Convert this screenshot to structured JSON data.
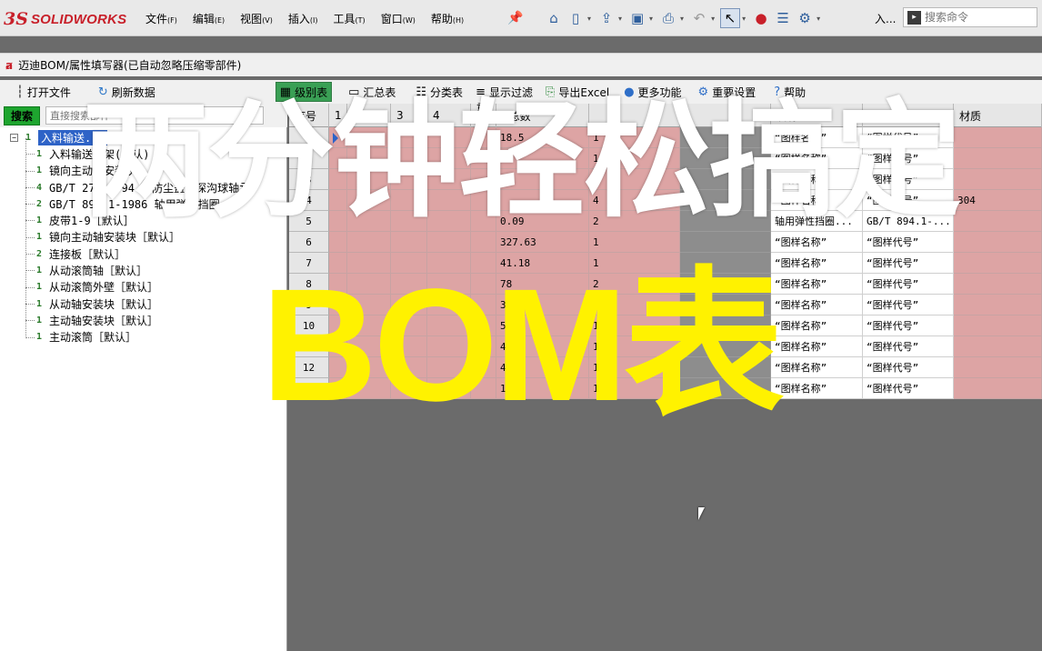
{
  "app": {
    "logo_prefix": "3S",
    "logo_name": "SOLIDWORKS",
    "menu": [
      {
        "label": "文件",
        "key": "(F)"
      },
      {
        "label": "编辑",
        "key": "(E)"
      },
      {
        "label": "视图",
        "key": "(V)"
      },
      {
        "label": "插入",
        "key": "(I)"
      },
      {
        "label": "工具",
        "key": "(T)"
      },
      {
        "label": "窗口",
        "key": "(W)"
      },
      {
        "label": "帮助",
        "key": "(H)"
      }
    ],
    "toolbar_icons": [
      "home-icon",
      "new-document-icon",
      "open-folder-icon",
      "save-icon",
      "print-icon",
      "undo-icon",
      "select-pointer-icon",
      "traffic-light-icon",
      "file-properties-icon",
      "options-gear-icon"
    ],
    "shortcut_label": "入...",
    "search_placeholder": "搜索命令"
  },
  "window": {
    "title": "迈迪BOM/属性填写器(已自动忽略压缩零部件)",
    "toolbar": {
      "open_file": "打开文件",
      "refresh": "刷新数据",
      "level_table": "级别表",
      "summary_table": "汇总表",
      "category_table": "分类表",
      "show_filter": "显示过滤",
      "export_excel": "导出Excel",
      "more": "更多功能",
      "settings": "重要设置",
      "help": "帮助"
    },
    "search_button": "搜索",
    "filter_placeholder": "直接搜索部件"
  },
  "tree": {
    "root": {
      "num": "1",
      "label": "入料输送..."
    },
    "children": [
      {
        "num": "1",
        "label": "入料输送带架(默认)"
      },
      {
        "num": "1",
        "label": "镜向主动轴安装块"
      },
      {
        "num": "4",
        "label": "GB/T 276-1994 带防尘盖的深沟球轴承"
      },
      {
        "num": "2",
        "label": "GB/T 894.1-1986 轴用弹性挡圈"
      },
      {
        "num": "1",
        "label": "皮带1-9［默认］"
      },
      {
        "num": "1",
        "label": "镜向主动轴安装块［默认］"
      },
      {
        "num": "2",
        "label": "连接板［默认］"
      },
      {
        "num": "1",
        "label": "从动滚筒轴［默认］"
      },
      {
        "num": "1",
        "label": "从动滚筒外壁［默认］"
      },
      {
        "num": "1",
        "label": "从动轴安装块［默认］"
      },
      {
        "num": "1",
        "label": "主动轴安装块［默认］"
      },
      {
        "num": "1",
        "label": "主动滚筒［默认］"
      }
    ]
  },
  "grid": {
    "headers": [
      "序号",
      "1",
      "2",
      "3",
      "4",
      "重量",
      "$总数",
      "",
      "",
      "名称",
      "代号",
      "材质"
    ],
    "rows": [
      {
        "idx": "1",
        "weight": "18.5",
        "qty": "1",
        "name": "“图样名称”",
        "code": "“图样代号”",
        "mat": ""
      },
      {
        "idx": "2",
        "weight": "",
        "qty": "1",
        "name": "“图样名称”",
        "code": "“图样代号”",
        "mat": ""
      },
      {
        "idx": "3",
        "weight": "1",
        "qty": "1",
        "name": "“图样名称”",
        "code": "“图样代号”",
        "mat": ""
      },
      {
        "idx": "4",
        "weight": "",
        "qty": "4",
        "name": "“图样名称”",
        "code": "“图样代号”",
        "mat": "304"
      },
      {
        "idx": "5",
        "weight": "0.09",
        "qty": "2",
        "name": "轴用弹性挡圈...",
        "code": "GB/T 894.1-...",
        "mat": ""
      },
      {
        "idx": "6",
        "weight": "327.63",
        "qty": "1",
        "name": "“图样名称”",
        "code": "“图样代号”",
        "mat": ""
      },
      {
        "idx": "7",
        "weight": "41.18",
        "qty": "1",
        "name": "“图样名称”",
        "code": "“图样代号”",
        "mat": ""
      },
      {
        "idx": "8",
        "weight": "78",
        "qty": "2",
        "name": "“图样名称”",
        "code": "“图样代号”",
        "mat": ""
      },
      {
        "idx": "9",
        "weight": "32",
        "qty": "1",
        "name": "“图样名称”",
        "code": "“图样代号”",
        "mat": ""
      },
      {
        "idx": "10",
        "weight": "56",
        "qty": "1",
        "name": "“图样名称”",
        "code": "“图样代号”",
        "mat": ""
      },
      {
        "idx": "11",
        "weight": "48",
        "qty": "1",
        "name": "“图样名称”",
        "code": "“图样代号”",
        "mat": ""
      },
      {
        "idx": "12",
        "weight": "41",
        "qty": "1",
        "name": "“图样名称”",
        "code": "“图样代号”",
        "mat": ""
      },
      {
        "idx": "13",
        "weight": "18",
        "qty": "1",
        "name": "“图样名称”",
        "code": "“图样代号”",
        "mat": ""
      }
    ]
  },
  "overlay": {
    "title": "两分钟轻松搞定",
    "subtitle": "BOM表"
  }
}
